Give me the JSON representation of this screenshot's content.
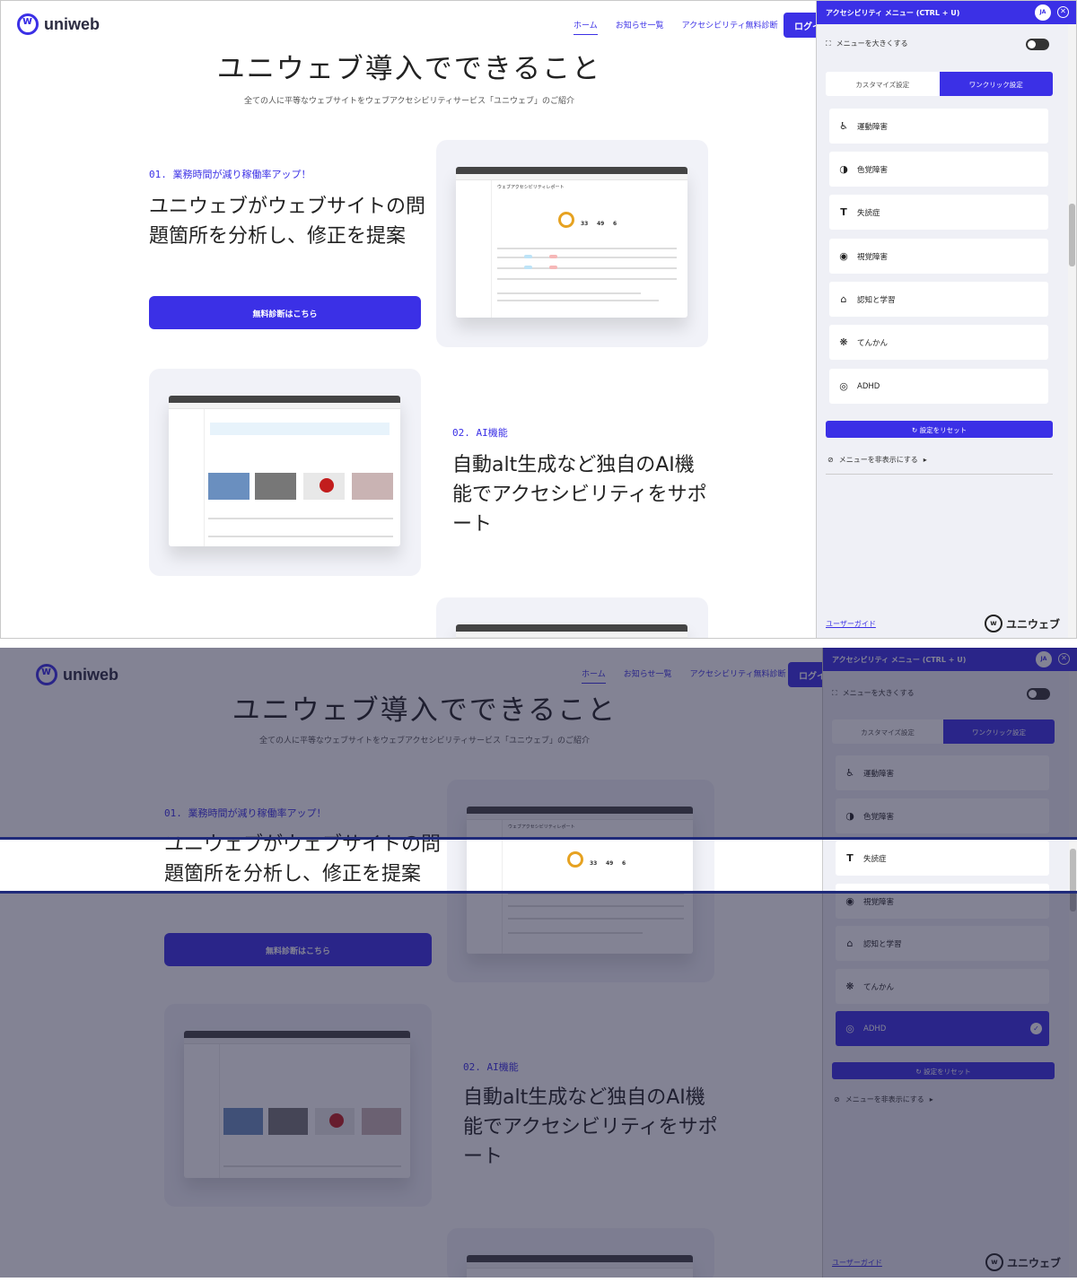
{
  "site": {
    "logo_text": "uniweb",
    "nav": [
      "ホーム",
      "お知らせ一覧",
      "アクセシビリティ無料診断"
    ],
    "login_label": "ログイ",
    "heading": "ユニウェブ導入でできること",
    "subheading": "全ての人に平等なウェブサイトをウェブアクセシビリティサービス「ユニウェブ」のご紹介",
    "feature1": {
      "kicker": "01. 業務時間が減り稼働率アップ！",
      "title": "ユニウェブがウェブサイトの問題箇所を分析し、修正を提案",
      "cta": "無料診断はこちら"
    },
    "feature2": {
      "kicker": "02. AI機能",
      "title": "自動alt生成など独自のAI機能でアクセシビリティをサポート"
    },
    "report_shot": {
      "title": "ウェブアクセシビリティレポート",
      "stats": [
        "33",
        "49",
        "6"
      ]
    }
  },
  "panel": {
    "title": "アクセシビリティ メニュー (CTRL + U)",
    "lang": "JA",
    "enlarge_label": "メニューを大きくする",
    "tab_customize": "カスタマイズ設定",
    "tab_oneclick": "ワンクリック設定",
    "options": [
      {
        "label": "運動障害",
        "icon": "wheelchair-icon"
      },
      {
        "label": "色覚障害",
        "icon": "contrast-icon"
      },
      {
        "label": "失読症",
        "icon": "text-icon"
      },
      {
        "label": "視覚障害",
        "icon": "eye-icon"
      },
      {
        "label": "認知と学習",
        "icon": "graduation-cap-icon"
      },
      {
        "label": "てんかん",
        "icon": "brain-icon"
      },
      {
        "label": "ADHD",
        "icon": "target-icon"
      }
    ],
    "reset_label": "設定をリセット",
    "hide_label": "メニューを非表示にする",
    "guide_label": "ユーザーガイド",
    "brand_text": "ユニウェブ"
  },
  "colors": {
    "accent": "#3b30e6",
    "panel_bg": "#eff0f6",
    "overlay": "#1f2a7a"
  }
}
